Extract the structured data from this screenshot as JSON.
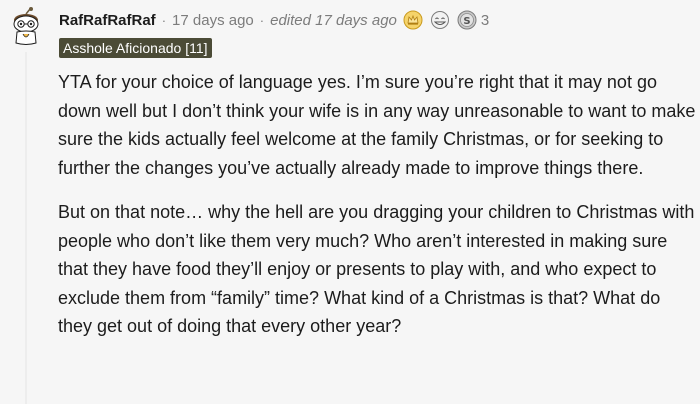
{
  "comment": {
    "username": "RafRafRafRaf",
    "time": "17 days ago",
    "edited": "edited 17 days ago",
    "flair": "Asshole Aficionado [11]",
    "award_count": "3",
    "paragraphs": [
      "YTA for your choice of language yes. I’m sure you’re right that it may not go down well but I don’t think your wife is in any way unreasonable to want to make sure the kids actually feel welcome at the family Christmas, or for seeking to further the changes you’ve actually already made to improve things there.",
      "But on that note… why the hell are you dragging your children to Christmas with people who don’t like them very much? Who aren’t interested in making sure that they have food they’ll enjoy or presents to play with, and who expect to exclude them from “family” time? What kind of a Christmas is that? What do they get out of doing that every other year?"
    ],
    "awards": [
      "crown-award-icon",
      "grin-award-icon",
      "silver-award-icon"
    ],
    "flair_color": "#4b4b36"
  }
}
